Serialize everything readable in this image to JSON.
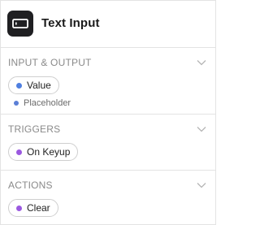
{
  "header": {
    "title": "Text Input",
    "icon": "text-input-icon"
  },
  "sections": {
    "io": {
      "title": "INPUT & OUTPUT",
      "pill_label": "Value",
      "pill_dot_color": "#4f7fe0",
      "sub_label": "Placeholder",
      "sub_dot_color": "#5b7fd6"
    },
    "triggers": {
      "title": "TRIGGERS",
      "pill_label": "On Keyup",
      "pill_dot_color": "#9b59e0"
    },
    "actions": {
      "title": "ACTIONS",
      "pill_label": "Clear",
      "pill_dot_color": "#9b59e0"
    }
  },
  "colors": {
    "border": "#e3e3e3",
    "section_title": "#8a8a8a",
    "header_icon_bg": "#1f1f22"
  }
}
